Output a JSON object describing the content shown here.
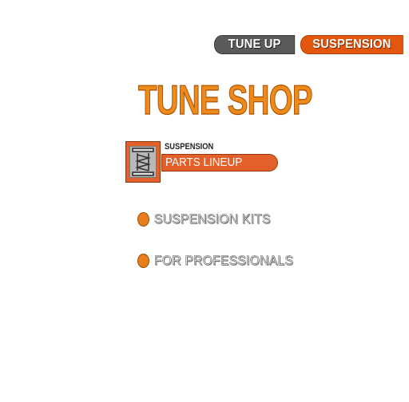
{
  "tabs": [
    {
      "label": "TUNE UP"
    },
    {
      "label": "SUSPENSION"
    }
  ],
  "title": "TUNE SHOP",
  "section": {
    "sublabel": "SUSPENSION",
    "label": "PARTS LINEUP",
    "icon": "suspension-parts-icon"
  },
  "menu": [
    {
      "label": "SUSPENSION KITS"
    },
    {
      "label": "FOR PROFESSIONALS"
    }
  ],
  "colors": {
    "accent": "#e2560e",
    "title": "#ee8a1a",
    "tab_inactive": "#5a5a5a",
    "bullet": "#e87d1b"
  }
}
